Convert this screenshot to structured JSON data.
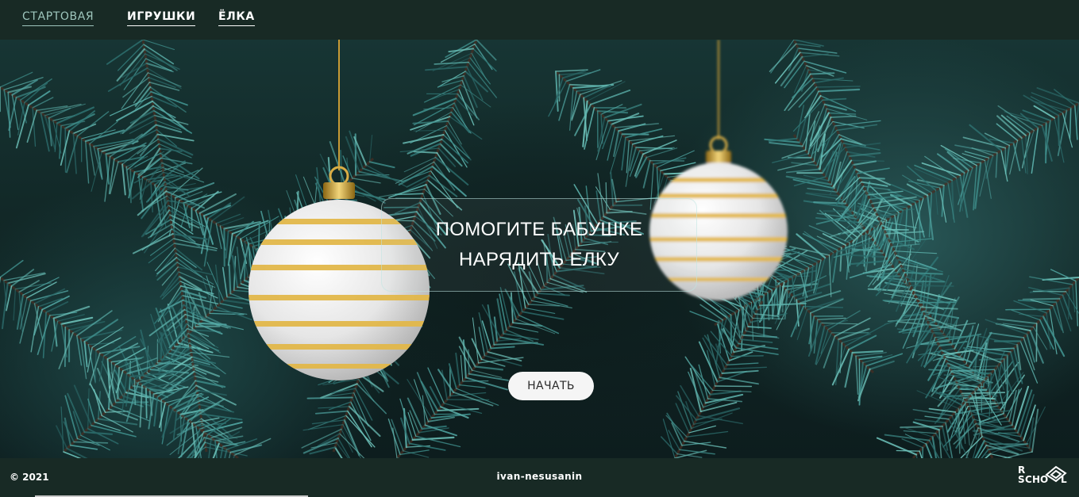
{
  "nav": {
    "home_label": "СТАРТОВАЯ",
    "toys_label": "ИГРУШКИ",
    "tree_label": "ЁЛКА"
  },
  "hero": {
    "message_line1": "ПОМОГИТЕ БАБУШКЕ",
    "message_line2": "НАРЯДИТЬ ЕЛКУ",
    "start_label": "НАЧАТЬ"
  },
  "footer": {
    "copyright": "© 2021",
    "author": "ivan-nesusanin",
    "logo_text": {
      "r": "R",
      "s": "S",
      "c": "C",
      "h": "H",
      "o": "O",
      "l": "L"
    }
  },
  "colors": {
    "header_bg": "#182a25",
    "active_nav": "#9ec6bd",
    "bauble_white": "#f2f2f2",
    "bauble_gold": "#e2b84a"
  },
  "icons": {
    "bauble_left": "christmas-ornament",
    "bauble_right": "christmas-ornament",
    "logo": "rs-school-logo"
  }
}
